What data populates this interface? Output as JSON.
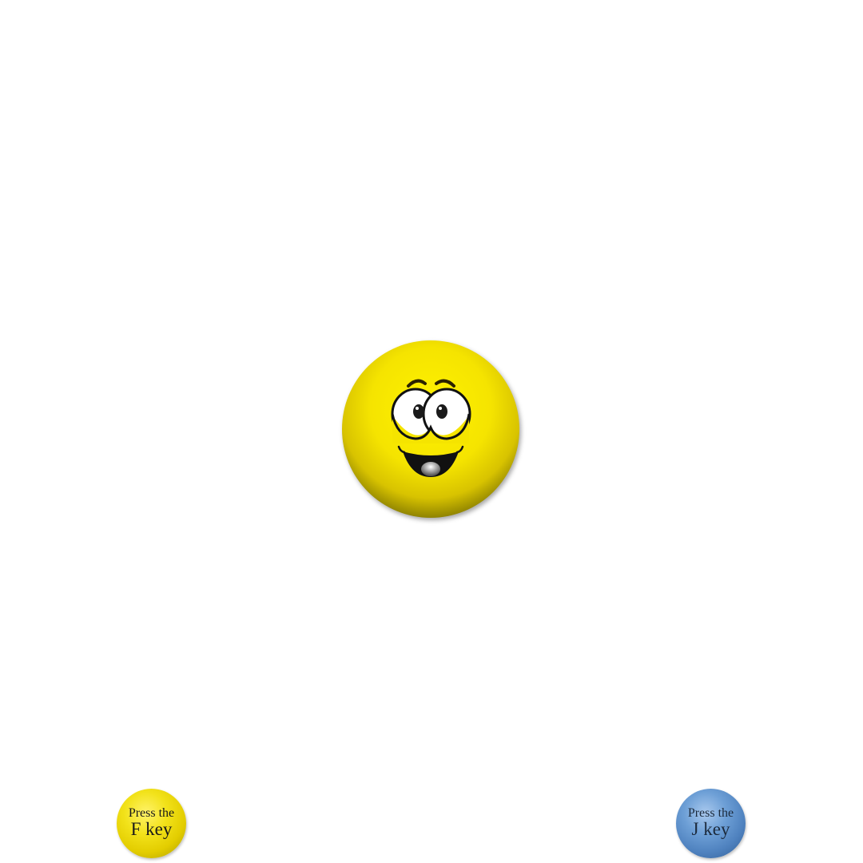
{
  "stimulus": {
    "icon": "smiley-face-icon",
    "color": "#f5e600"
  },
  "left_key": {
    "line1": "Press the",
    "line2": "F key",
    "color": "#e8d600"
  },
  "right_key": {
    "line1": "Press the",
    "line2": "J key",
    "color": "#4f82bf"
  }
}
